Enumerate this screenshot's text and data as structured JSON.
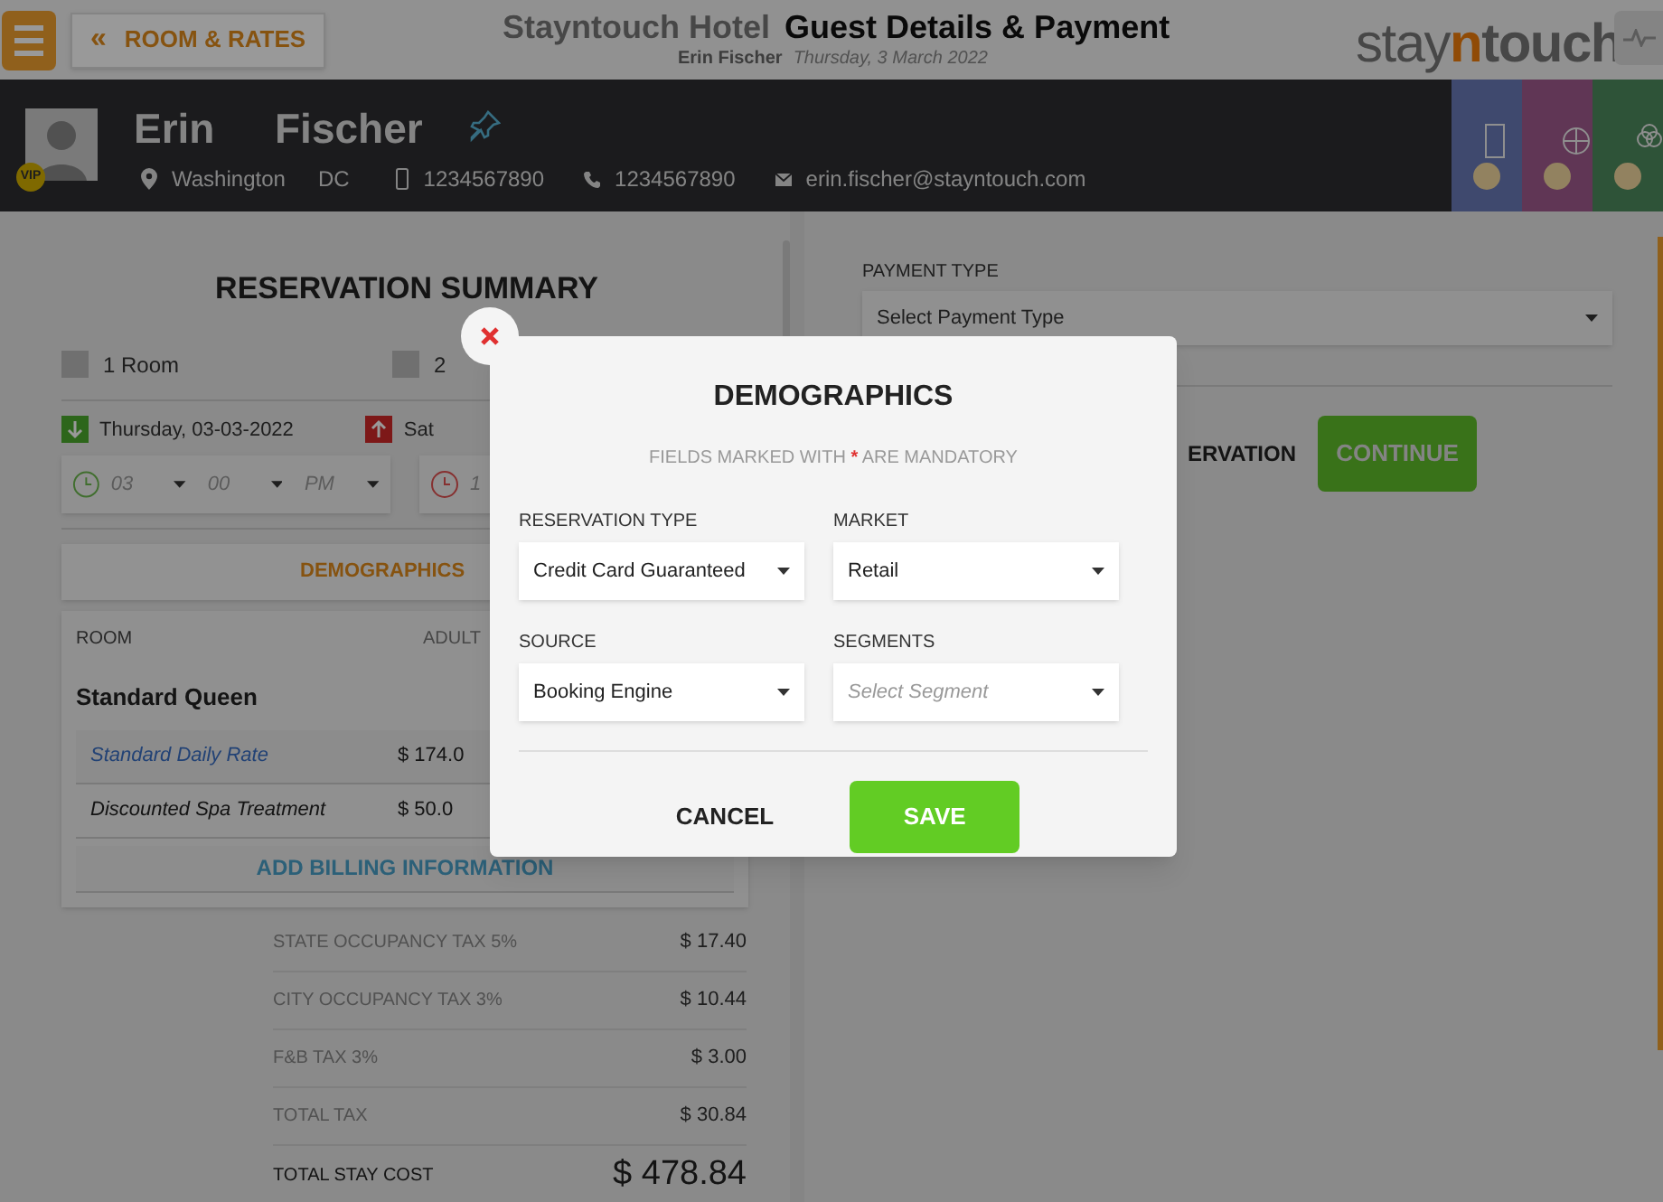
{
  "header": {
    "back_icon": "«",
    "back_button": "ROOM & RATES",
    "hotel": "Stayntouch Hotel",
    "title": "Guest Details & Payment",
    "guest": "Erin Fischer",
    "date": "Thursday, 3 March 2022",
    "logo": {
      "before": "stay",
      "highlight": "n",
      "after": "touch"
    }
  },
  "guest": {
    "first_name": "Erin",
    "last_name": "Fischer",
    "vip": "VIP",
    "city": "Washington",
    "state": "DC",
    "mobile": "1234567890",
    "phone": "1234567890",
    "email": "erin.fischer@stayntouch.com"
  },
  "summary": {
    "title": "RESERVATION SUMMARY",
    "rooms": "1 Room",
    "nights": "2",
    "arrival": "Thursday, 03-03-2022",
    "departure": "Sat",
    "arrival_time": {
      "hour": "03",
      "minute": "00",
      "ampm": "PM"
    },
    "departure_time": "1",
    "demographics_button": "DEMOGRAPHICS",
    "columns": [
      "ROOM",
      "ADULT"
    ],
    "room_name": "Standard Queen",
    "rates": [
      {
        "name": "Standard Daily Rate",
        "amount": "$ 174.0",
        "kind": "link"
      },
      {
        "name": "Discounted Spa Treatment",
        "amount": "$ 50.0",
        "kind": "plain"
      }
    ],
    "add_billing": "ADD BILLING INFORMATION",
    "taxes": [
      {
        "label": "STATE OCCUPANCY TAX 5%",
        "amount": "$ 17.40"
      },
      {
        "label": "CITY OCCUPANCY TAX 3%",
        "amount": "$ 10.44"
      },
      {
        "label": "F&B TAX 3%",
        "amount": "$ 3.00"
      },
      {
        "label": "TOTAL TAX",
        "amount": "$ 30.84"
      }
    ],
    "total": {
      "label": "TOTAL STAY COST",
      "amount": "$ 478.84"
    }
  },
  "payment": {
    "label": "PAYMENT TYPE",
    "placeholder": "Select Payment Type",
    "cancel_button": "ERVATION",
    "continue_button": "CONTINUE"
  },
  "modal": {
    "title": "DEMOGRAPHICS",
    "note": {
      "before": "FIELDS MARKED WITH",
      "mark": "*",
      "after": "ARE MANDATORY"
    },
    "fields": [
      {
        "label": "RESERVATION TYPE",
        "value": "Credit Card Guaranteed"
      },
      {
        "label": "MARKET",
        "value": "Retail"
      },
      {
        "label": "SOURCE",
        "value": "Booking Engine"
      },
      {
        "label": "SEGMENTS",
        "placeholder": "Select Segment"
      }
    ],
    "cancel_button": "CANCEL",
    "save_button": "SAVE"
  }
}
